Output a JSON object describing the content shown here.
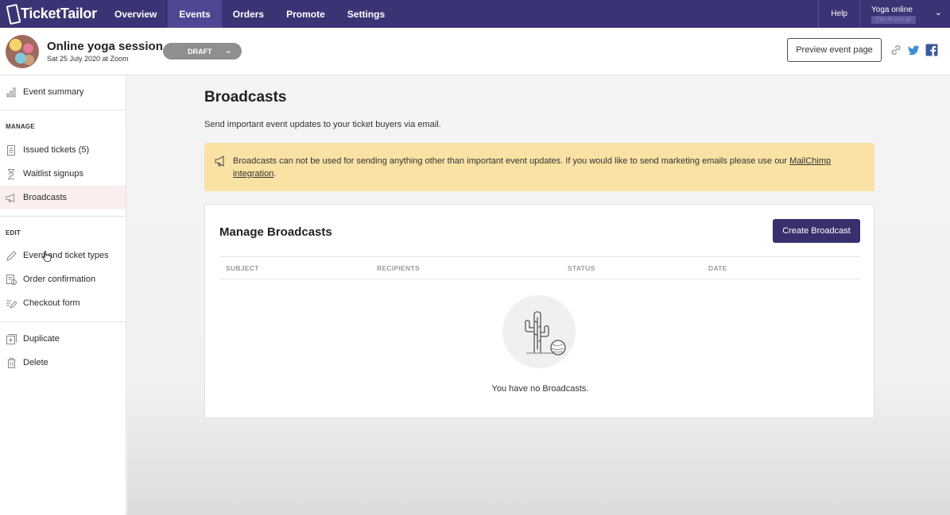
{
  "topbar": {
    "brand": "TicketTailor",
    "nav": [
      "Overview",
      "Events",
      "Orders",
      "Promote",
      "Settings"
    ],
    "active_nav": "Events",
    "help": "Help",
    "account_name": "Yoga online",
    "account_sub": "Pay as you go"
  },
  "event": {
    "title": "Online yoga session",
    "date": "Sat 25 July 2020 at Zoom",
    "status": "DRAFT",
    "preview_label": "Preview event page"
  },
  "sidebar": {
    "summary": "Event summary",
    "manage_heading": "MANAGE",
    "manage_items": [
      "Issued tickets (5)",
      "Waitlist signups",
      "Broadcasts"
    ],
    "edit_heading": "EDIT",
    "edit_items": [
      "Event and ticket types",
      "Order confirmation",
      "Checkout form"
    ],
    "other_items": [
      "Duplicate",
      "Delete"
    ]
  },
  "main": {
    "title": "Broadcasts",
    "subtitle": "Send important event updates to your ticket buyers via email.",
    "notice_text": "Broadcasts can not be used for sending anything other than important event updates. If you would like to send marketing emails please use our ",
    "notice_link": "MailChimp integration",
    "notice_end": ".",
    "card_title": "Manage Broadcasts",
    "create_label": "Create Broadcast",
    "columns": [
      "SUBJECT",
      "RECIPIENTS",
      "STATUS",
      "DATE"
    ],
    "empty_text": "You have no Broadcasts."
  },
  "colors": {
    "nav_bg": "#3b3474",
    "primary_button": "#37306c",
    "notice_bg": "#f9e2a4",
    "active_sidebar": "#fbeeee"
  }
}
